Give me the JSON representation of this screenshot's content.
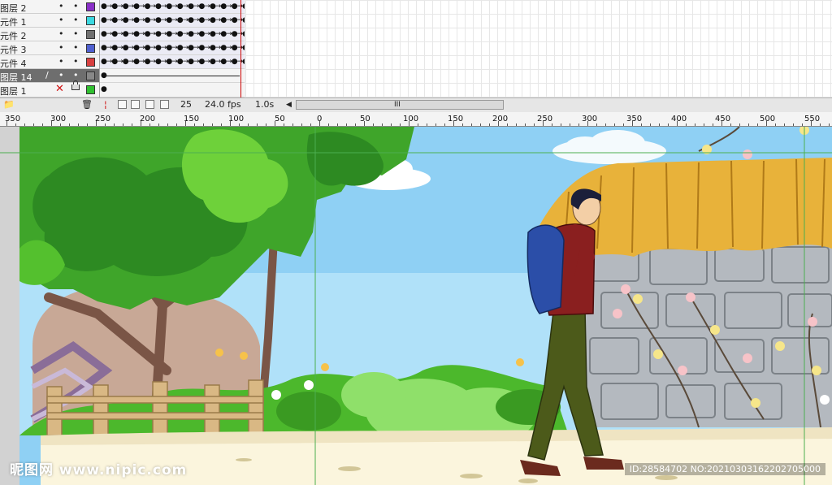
{
  "layers": [
    {
      "name": "图层 2",
      "color": "#8a2fc8",
      "selected": false
    },
    {
      "name": "元件 1",
      "color": "#3bd8e0",
      "selected": false
    },
    {
      "name": "元件 2",
      "color": "#707070",
      "selected": false
    },
    {
      "name": "元件 3",
      "color": "#5060d0",
      "selected": false
    },
    {
      "name": "元件 4",
      "color": "#d84040",
      "selected": false
    },
    {
      "name": "图层 14",
      "color": "#888888",
      "selected": true
    },
    {
      "name": "图层 1",
      "color": "#30c030",
      "selected": false
    }
  ],
  "frame_rows": {
    "tween_pattern": "●→●→●→●→●→●→●→●→●→●→●→●→●→●→●→●",
    "end_dot": "●"
  },
  "timeline_status": {
    "current_frame": "25",
    "frame_rate": "24.0 fps",
    "elapsed_time": "1.0s",
    "scroll_grip": "III"
  },
  "ruler": {
    "labels": [
      "350",
      "300",
      "250",
      "200",
      "150",
      "100",
      "50",
      "0",
      "50",
      "100",
      "150",
      "200",
      "250",
      "300",
      "350",
      "400",
      "450",
      "500",
      "550"
    ]
  },
  "icons": {
    "visibility": "•",
    "lock": "•",
    "pencil": "/",
    "delete_x": "✕",
    "trash": "🗑",
    "new_layer": "📁",
    "onion": "⌷"
  },
  "watermark": {
    "site": "昵图网 www.nipic.com",
    "id_text": "ID:28584702 NO:20210303162202705000"
  },
  "colors": {
    "sky": "#8fd0f4",
    "tree_green": "#3fa52a",
    "path": "#fbf5dd",
    "wall": "#b4b9bf",
    "thatch": "#e8b23a",
    "jacket": "#8a1f1f",
    "trousers": "#4c5a1a",
    "backpack": "#2b4ea8"
  }
}
